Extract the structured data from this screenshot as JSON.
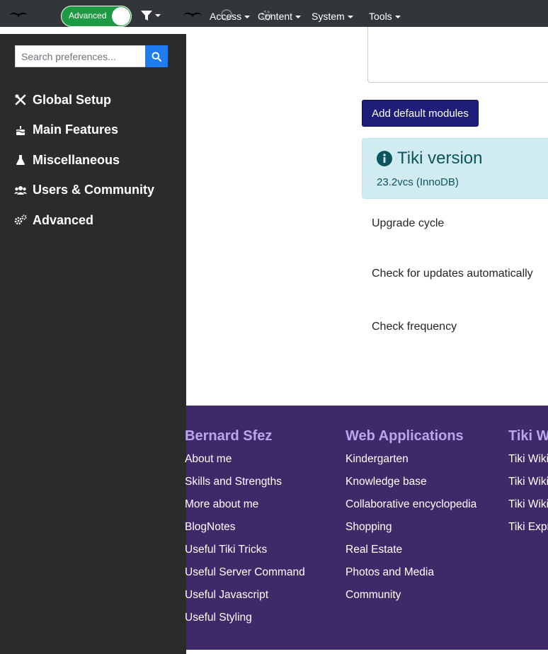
{
  "topbar": {
    "toggle_label": "Advanced",
    "nav": [
      {
        "label": "Access"
      },
      {
        "label": "Content"
      },
      {
        "label": "System"
      },
      {
        "label": "Tools"
      }
    ]
  },
  "sidebar": {
    "search_placeholder": "Search preferences...",
    "items": [
      {
        "label": "Global Setup",
        "icon": "tools-icon"
      },
      {
        "label": "Main Features",
        "icon": "cake-icon"
      },
      {
        "label": "Miscellaneous",
        "icon": "flask-icon"
      },
      {
        "label": "Users & Community",
        "icon": "users-icon"
      },
      {
        "label": "Advanced",
        "icon": "cogs-icon"
      }
    ]
  },
  "main": {
    "add_button": "Add default modules",
    "version_title": "Tiki version",
    "version_value": "23.2vcs (InnoDB)",
    "prefs": [
      "Upgrade cycle",
      "Check for updates automatically",
      "Check frequency"
    ]
  },
  "footer": {
    "columns": [
      {
        "title": "Bernard Sfez",
        "links": [
          "About me",
          "Skills and Strengths",
          "More about me",
          "BlogNotes",
          "Useful Tiki Tricks",
          "Useful Server Command",
          "Useful Javascript",
          "Useful Styling"
        ]
      },
      {
        "title": "Web Applications",
        "links": [
          "Kindergarten",
          "Knowledge base",
          "Collaborative encyclopedia",
          "Shopping",
          "Real Estate",
          "Photos and Media",
          "Community"
        ]
      },
      {
        "title": "Tiki Wi",
        "links": [
          "Tiki Wiki",
          "Tiki Wiki",
          "Tiki Wiki",
          "Tiki Expr"
        ]
      }
    ]
  },
  "colors": {
    "topbar": "#32363a",
    "sidebar": "#2b2b2b",
    "footer": "#3e2a68",
    "footer_heading": "#b8a6f0",
    "primary_button": "#1f1d7a",
    "info_box": "#d1ecf1",
    "toggle_on": "#1e9a44"
  }
}
